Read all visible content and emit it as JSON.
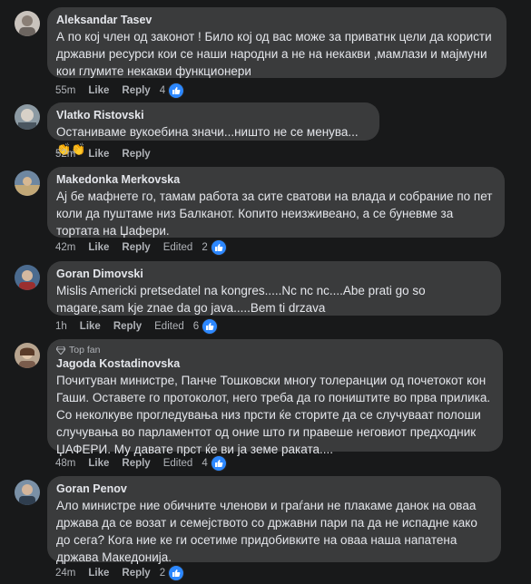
{
  "comments": [
    {
      "name": "Aleksandar Tasev",
      "text": "А по кој член од законот ! Било кој од вас може за приватнк цели да користи државни ресурси кои се наши народни а не на некакви ,мамлази и мајмуни кои глумите некакви функционери",
      "time": "55m",
      "like": "Like",
      "reply": "Reply",
      "edited": "",
      "reactions": "4"
    },
    {
      "name": "Vlatko Ristovski",
      "text": "Останиваме вукоебина значи...ништо не се менува...",
      "emoji": "👏👏",
      "time": "52m",
      "like": "Like",
      "reply": "Reply",
      "edited": "",
      "reactions": ""
    },
    {
      "name": "Makedonka Merkovska",
      "text": "Ај бе мафнете го, тамам работа за сите сватови на влада и собрание по пет коли да пуштаме низ Балканот. Копито неизживеано, а се буневме за тортата на Џафери.",
      "time": "42m",
      "like": "Like",
      "reply": "Reply",
      "edited": "Edited",
      "reactions": "2"
    },
    {
      "name": "Goran Dimovski",
      "text": "Mislis Americki pretsedatel na kongres.....Nc nc nc....Abe prati go so magare,sam kje znae da go java.....Bem ti drzava",
      "time": "1h",
      "like": "Like",
      "reply": "Reply",
      "edited": "Edited",
      "reactions": "6"
    },
    {
      "badge": "Top fan",
      "name": "Jagoda Kostadinovska",
      "text": "Почитуван министре, Панче Тошковски многу толеранции од почетокот кон Гаши. Оставете го протоколот, него треба да го поништите во прва прилика. Со неколкуве прогледувања низ прсти ќе сторите да се случуваат полоши случувања во парламентот од оние што ги правеше неговиот предходник ЏАФЕРИ. Му давате прст ќе ви ја земе раката....",
      "time": "48m",
      "like": "Like",
      "reply": "Reply",
      "edited": "Edited",
      "reactions": "4"
    },
    {
      "name": "Goran Penov",
      "text": "Ало министре ние обичните членови и граѓани не плакаме данок на оваа држава да се возат и семејството со државни пари па да не испадне како до сега? Кога ние ке ги осетиме придобивките на оваа наша напатена држава Македонија.",
      "time": "24m",
      "like": "Like",
      "reply": "Reply",
      "edited": "",
      "reactions": "2"
    }
  ],
  "colors": {
    "background": "#18191a",
    "bubble": "#3a3b3c",
    "like_blue": "#2d88ff"
  }
}
